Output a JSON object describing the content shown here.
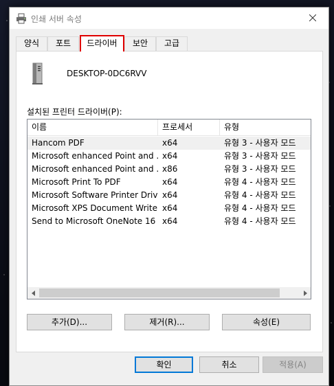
{
  "window": {
    "title": "인쇄 서버 속성",
    "icons": {
      "app": "printer-icon",
      "close": "close-icon"
    }
  },
  "tabs": [
    {
      "label": "양식"
    },
    {
      "label": "포트"
    },
    {
      "label": "드라이버",
      "active": true
    },
    {
      "label": "보안"
    },
    {
      "label": "고급"
    }
  ],
  "server": {
    "name": "DESKTOP-0DC6RVV",
    "icon": "server-tower-icon"
  },
  "drivers": {
    "label": "설치된 프린터 드라이버(P):",
    "columns": [
      "이름",
      "프로세서",
      "유형"
    ],
    "rows": [
      [
        "Hancom PDF",
        "x64",
        "유형 3 - 사용자 모드"
      ],
      [
        "Microsoft enhanced Point and ...",
        "x64",
        "유형 3 - 사용자 모드"
      ],
      [
        "Microsoft enhanced Point and ...",
        "x86",
        "유형 3 - 사용자 모드"
      ],
      [
        "Microsoft Print To PDF",
        "x64",
        "유형 4 - 사용자 모드"
      ],
      [
        "Microsoft Software Printer Driver",
        "x64",
        "유형 4 - 사용자 모드"
      ],
      [
        "Microsoft XPS Document Write...",
        "x64",
        "유형 4 - 사용자 모드"
      ],
      [
        "Send to Microsoft OneNote 16 ...",
        "x64",
        "유형 4 - 사용자 모드"
      ]
    ],
    "selected_index": 0
  },
  "panel_buttons": {
    "add": "추가(D)...",
    "remove": "제거(R)...",
    "properties": "속성(E)"
  },
  "footer_buttons": {
    "ok": "확인",
    "cancel": "취소",
    "apply": "적용(A)"
  },
  "colors": {
    "active_tab_highlight": "#e00000",
    "primary_button_border": "#0078d7"
  }
}
